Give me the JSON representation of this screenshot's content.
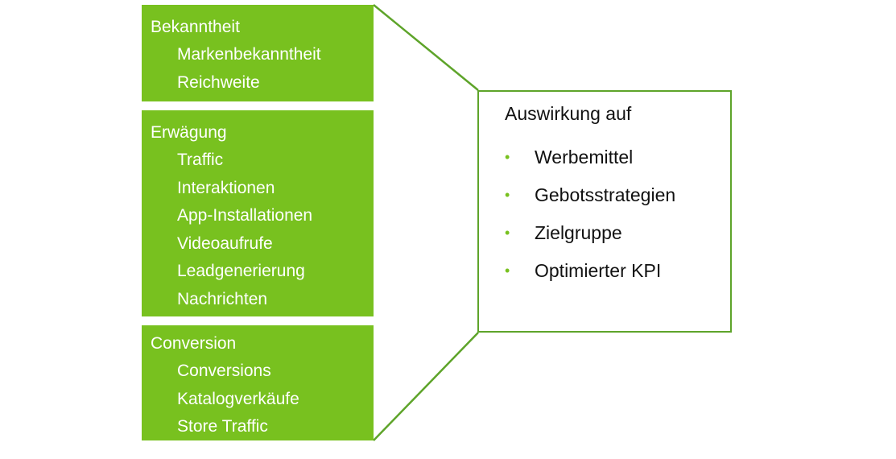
{
  "colors": {
    "box_fill": "#78c11f",
    "connector": "#5ea42a",
    "bullet": "#78c11f"
  },
  "groups": [
    {
      "title": "Bekanntheit",
      "items": [
        "Markenbekanntheit",
        "Reichweite"
      ]
    },
    {
      "title": "Erwägung",
      "items": [
        "Traffic",
        "Interaktionen",
        "App-Installationen",
        "Videoaufrufe",
        "Leadgenerierung",
        "Nachrichten"
      ]
    },
    {
      "title": "Conversion",
      "items": [
        "Conversions",
        "Katalogverkäufe",
        "Store Traffic"
      ]
    }
  ],
  "impact": {
    "title": "Auswirkung auf",
    "bullet_icon": "bullet-dot",
    "items": [
      "Werbemittel",
      "Gebotsstrategien",
      "Zielgruppe",
      "Optimierter KPI"
    ]
  }
}
